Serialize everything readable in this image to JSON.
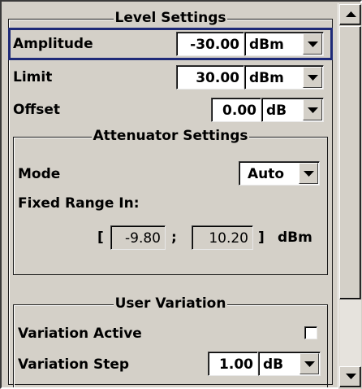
{
  "level_settings": {
    "title": "Level Settings",
    "amplitude": {
      "label": "Amplitude",
      "value": "-30.00",
      "unit": "dBm"
    },
    "limit": {
      "label": "Limit",
      "value": "30.00",
      "unit": "dBm"
    },
    "offset": {
      "label": "Offset",
      "value": "0.00",
      "unit": "dB"
    }
  },
  "attenuator_settings": {
    "title": "Attenuator Settings",
    "mode": {
      "label": "Mode",
      "value": "Auto"
    },
    "fixed_range": {
      "label": "Fixed Range In:",
      "open_bracket": "[",
      "min": "-9.80",
      "separator": ";",
      "max": "10.20",
      "close_bracket": "]",
      "unit": "dBm"
    }
  },
  "user_variation": {
    "title": "User Variation",
    "variation_active": {
      "label": "Variation Active",
      "checked": false
    },
    "variation_step": {
      "label": "Variation Step",
      "value": "1.00",
      "unit": "dB"
    }
  },
  "colors": {
    "panel": "#d4d0c8",
    "focus": "#1e2a78"
  },
  "icons": {
    "dropdown": "chevron-down-icon",
    "scroll_up": "arrow-up-icon",
    "scroll_down": "arrow-down-icon"
  }
}
